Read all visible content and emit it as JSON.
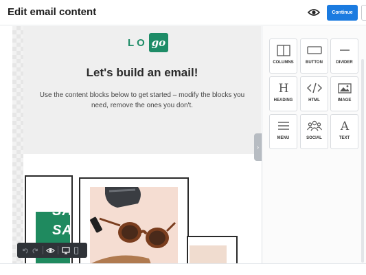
{
  "header": {
    "title": "Edit email content",
    "continue_label": "Continue",
    "preview_icon": "eye-icon"
  },
  "email": {
    "logo_lo": "LO",
    "logo_go": "go",
    "heading": "Let's build an email!",
    "body": "Use the content blocks below to get started – modify the blocks you need, remove the ones you don't.",
    "sale_line1": "SAL",
    "sale_line2": "SAL"
  },
  "toolbar": {
    "icons": [
      "undo-icon",
      "redo-icon",
      "eye-icon",
      "desktop-icon",
      "mobile-icon"
    ]
  },
  "panel": {
    "blocks": [
      {
        "label": "COLUMNS",
        "icon": "columns-icon"
      },
      {
        "label": "BUTTON",
        "icon": "button-icon"
      },
      {
        "label": "DIVIDER",
        "icon": "divider-icon"
      },
      {
        "label": "HEADING",
        "icon": "heading-icon"
      },
      {
        "label": "HTML",
        "icon": "html-icon"
      },
      {
        "label": "IMAGE",
        "icon": "image-icon"
      },
      {
        "label": "MENU",
        "icon": "menu-icon"
      },
      {
        "label": "SOCIAL",
        "icon": "social-icon"
      },
      {
        "label": "TEXT",
        "icon": "text-icon"
      }
    ]
  },
  "colors": {
    "accent": "#1b7be0",
    "brand_green": "#1e8c67"
  }
}
